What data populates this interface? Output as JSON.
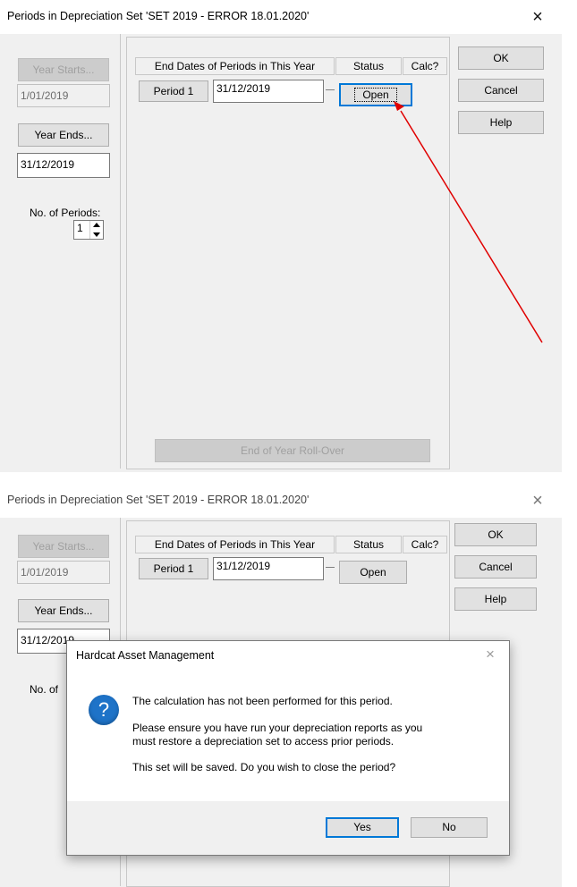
{
  "window": {
    "title": "Periods in Depreciation Set 'SET 2019 - ERROR 18.01.2020'",
    "close_glyph": "×"
  },
  "left_panel": {
    "year_starts_label": "Year Starts...",
    "year_starts_value": "1/01/2019",
    "year_ends_label": "Year Ends...",
    "year_ends_value": "31/12/2019",
    "num_periods_label": "No. of Periods:",
    "num_periods_value": "1",
    "num_periods_label_partial": "No. of"
  },
  "periods_table": {
    "columns": [
      "End Dates of Periods in This Year",
      "Status",
      "Calc?"
    ],
    "rows": [
      {
        "period_label": "Period 1",
        "end_date": "31/12/2019",
        "status_button": "Open"
      }
    ]
  },
  "right_buttons": {
    "ok": "OK",
    "cancel": "Cancel",
    "help": "Help"
  },
  "rollover_button": "End of Year Roll-Over",
  "message_box": {
    "title": "Hardcat Asset Management",
    "close_glyph": "×",
    "icon": "question-icon",
    "lines": [
      "The calculation has not been performed for this period.",
      "Please ensure you have run your depreciation reports as you",
      "must restore a depreciation set to access prior periods.",
      "This set will be saved.  Do you wish to close the period?"
    ],
    "yes": "Yes",
    "no": "No"
  },
  "annotation": {
    "arrow_color": "#e00000"
  }
}
